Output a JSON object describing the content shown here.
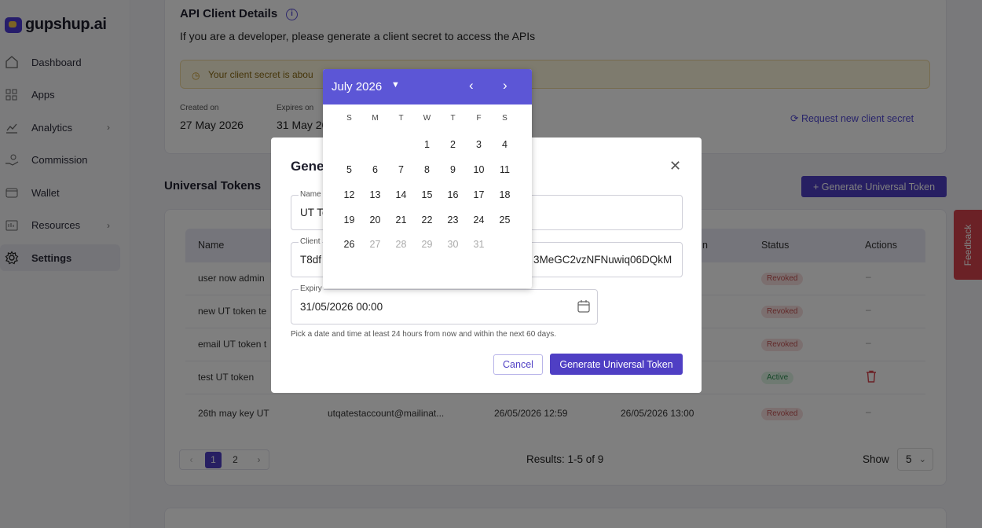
{
  "brand": "gupshup.ai",
  "sidebar": {
    "items": [
      {
        "label": "Dashboard",
        "icon": "home-icon"
      },
      {
        "label": "Apps",
        "icon": "grid-icon"
      },
      {
        "label": "Analytics",
        "icon": "chart-icon"
      },
      {
        "label": "Commission",
        "icon": "hand-coins-icon"
      },
      {
        "label": "Wallet",
        "icon": "wallet-icon"
      },
      {
        "label": "Resources",
        "icon": "book-icon"
      },
      {
        "label": "Settings",
        "icon": "gear-icon"
      }
    ]
  },
  "api": {
    "title": "API Client Details",
    "subtitle": "If you are a developer, please generate a client secret to access the APIs",
    "warning": "Your client secret is abou",
    "created_label": "Created on",
    "created_value": "27 May 2026",
    "expires_label": "Expires on",
    "expires_value": "31 May 20",
    "request_link": "Request new client secret"
  },
  "tokens": {
    "title": "Universal Tokens",
    "generate_button": "+ Generate Universal Token",
    "columns": {
      "name": "Name",
      "expiry": "n",
      "status": "Status",
      "actions": "Actions"
    },
    "rows": [
      {
        "name": "user now admin",
        "email": "",
        "created": "",
        "expiry": "",
        "status": "Revoked",
        "action": "–"
      },
      {
        "name": "new UT token te",
        "email": "",
        "created": "",
        "expiry": "",
        "status": "Revoked",
        "action": "–"
      },
      {
        "name": "email UT token t",
        "email": "",
        "created": "",
        "expiry": "",
        "status": "Revoked",
        "action": "–"
      },
      {
        "name": "test UT token",
        "email": "",
        "created": "",
        "expiry": "",
        "status": "Active",
        "action": "delete"
      },
      {
        "name": "26th may key UT",
        "email": "utqatestaccount@mailinat...",
        "created": "26/05/2026 12:59",
        "expiry": "26/05/2026 13:00",
        "status": "Revoked",
        "action": "–"
      }
    ],
    "pages": [
      "1",
      "2"
    ],
    "results": "Results: 1-5 of 9",
    "show_label": "Show",
    "show_value": "5"
  },
  "feedback": "Feedback",
  "modal": {
    "title": "Gene",
    "name_label": "Name",
    "name_value": "UT To",
    "client_label": "Client",
    "client_value_left": "T8df",
    "client_value_right": "3MeGC2vzNFNuwiq06DQkM",
    "expiry_label": "Expiry",
    "expiry_value": "31/05/2026 00:00",
    "hint": "Pick a date and time at least 24 hours from now and within the next 60 days.",
    "cancel": "Cancel",
    "submit": "Generate Universal Token"
  },
  "datepicker": {
    "month": "July 2026",
    "weekdays": [
      "S",
      "M",
      "T",
      "W",
      "T",
      "F",
      "S"
    ],
    "weeks": [
      [
        "",
        "",
        "",
        "1",
        "2",
        "3",
        "4"
      ],
      [
        "5",
        "6",
        "7",
        "8",
        "9",
        "10",
        "11"
      ],
      [
        "12",
        "13",
        "14",
        "15",
        "16",
        "17",
        "18"
      ],
      [
        "19",
        "20",
        "21",
        "22",
        "23",
        "24",
        "25"
      ],
      [
        "26",
        "27",
        "28",
        "29",
        "30",
        "31",
        ""
      ]
    ],
    "disabled_days": [
      "27",
      "28",
      "29",
      "30",
      "31"
    ]
  },
  "colors": {
    "accent": "#4f3fc4",
    "picker_header": "#5c56d6",
    "feedback": "#d6434c"
  }
}
